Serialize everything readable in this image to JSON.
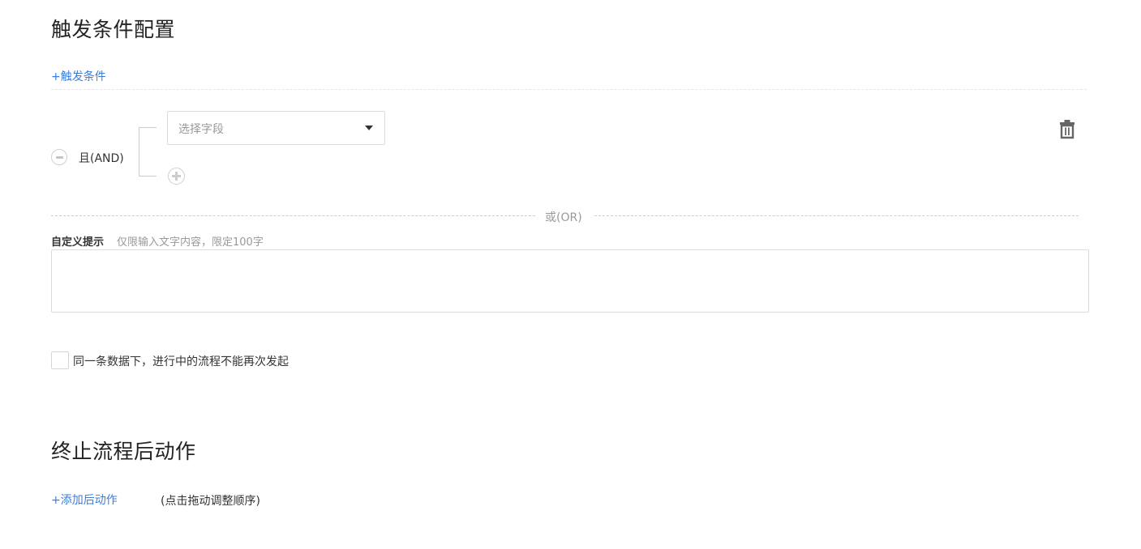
{
  "trigger_section": {
    "title": "触发条件配置",
    "add_trigger_label": "+触发条件",
    "condition_group": {
      "logic_label": "且(AND)",
      "field_select": {
        "placeholder": "选择字段"
      }
    },
    "or_divider_label": "或(OR)",
    "custom_prompt": {
      "label": "自定义提示",
      "hint": "仅限输入文字内容，限定100字",
      "value": ""
    },
    "no_restart_checkbox": {
      "label": "同一条数据下，进行中的流程不能再次发起",
      "checked": false
    }
  },
  "terminate_section": {
    "title": "终止流程后动作",
    "add_action_label": "+添加后动作",
    "hint": "(点击拖动调整顺序)"
  },
  "icons": {
    "remove_group": "minus-circle-icon",
    "add_condition": "plus-circle-icon",
    "delete_group": "trash-icon",
    "dropdown": "caret-down-icon"
  },
  "colors": {
    "link": "#3b7ddd",
    "placeholder": "#999999",
    "text": "#333333",
    "border": "#dcdcdc"
  }
}
